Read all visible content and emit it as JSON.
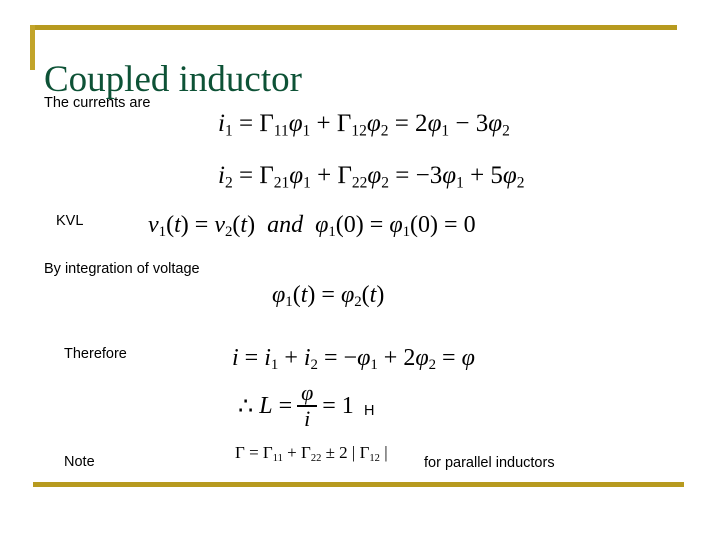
{
  "slide": {
    "title": "Coupled inductor",
    "accent_gold": "#b79a1f",
    "title_green": "#0d5236",
    "labels": {
      "currents": "The currents are",
      "kvl": "KVL",
      "integration": "By integration of voltage",
      "therefore": "Therefore",
      "note": "Note",
      "henry_unit": "H",
      "parallel": "for parallel inductors"
    },
    "equations": {
      "current_1": {
        "lhs": "i",
        "lhs_sub": "1",
        "text": "i₁ = Γ₁₁φ₁ + Γ₁₂φ₂ = 2φ₁ − 3φ₂"
      },
      "current_2": {
        "text": "i₂ = Γ₂₁φ₁ + Γ₂₂φ₂ = −3φ₁ + 5φ₂"
      },
      "kvl": {
        "text": "v₁(t) = v₂(t) and φ₁(0) = φ₁(0) = 0",
        "conjunction": "and"
      },
      "flux_equal": {
        "text": "φ₁(t) = φ₂(t)"
      },
      "total_current": {
        "text": "i = i₁ + i₂ = −φ₁ + 2φ₂ = φ"
      },
      "inductance": {
        "prefix": "∴",
        "symbol": "L",
        "numerator": "φ",
        "denominator": "i",
        "value": "1"
      },
      "gamma_parallel": {
        "text": "Γ = Γ₁₁ + Γ₂₂ ± 2 | Γ₁₂ |"
      }
    }
  }
}
